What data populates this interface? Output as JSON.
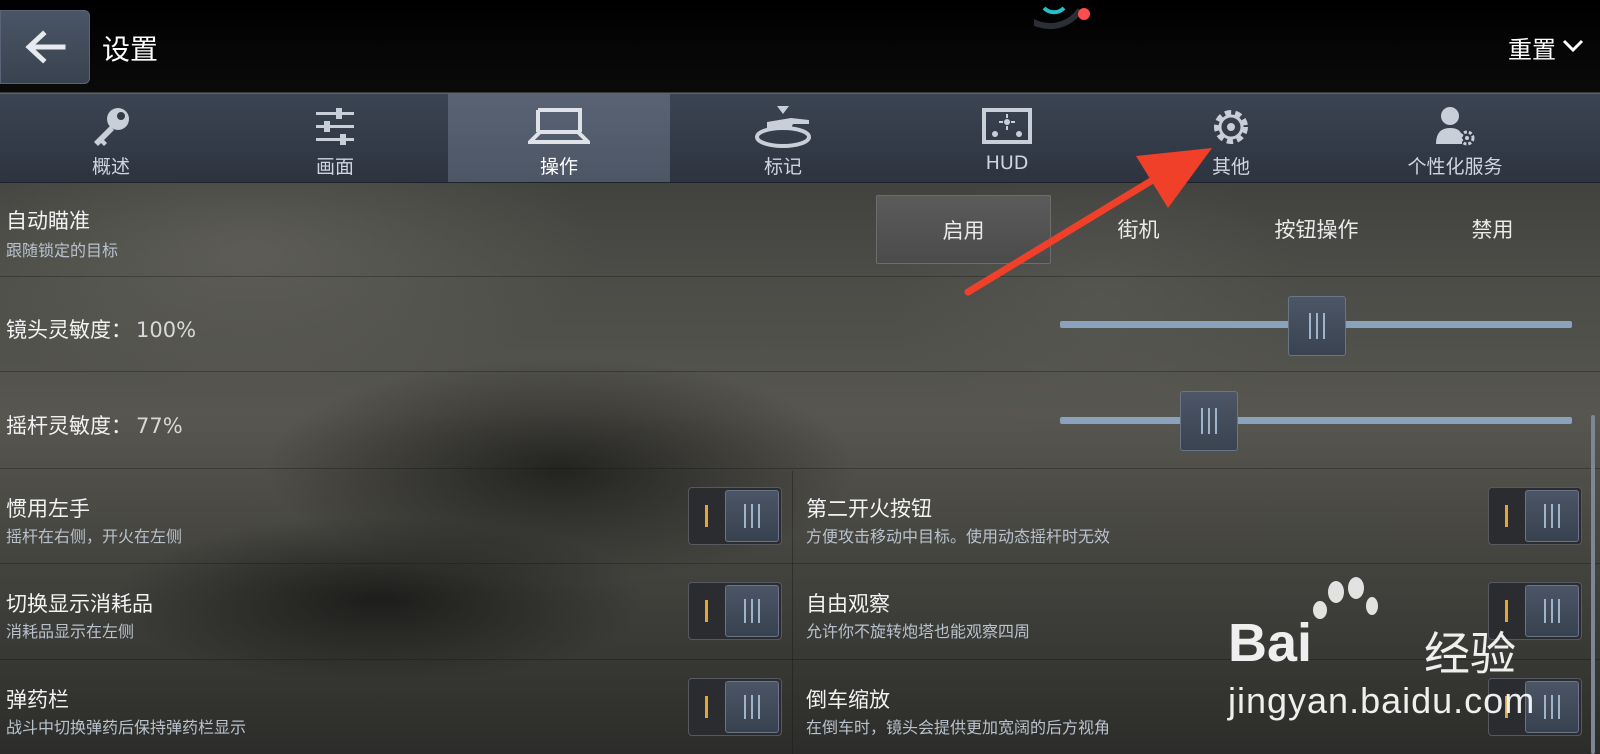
{
  "header": {
    "title": "设置",
    "reset_label": "重置"
  },
  "tabs": [
    {
      "label": "概述",
      "icon": "key-icon"
    },
    {
      "label": "画面",
      "icon": "sliders-icon"
    },
    {
      "label": "操作",
      "icon": "controls-icon",
      "active": true
    },
    {
      "label": "标记",
      "icon": "tank-icon"
    },
    {
      "label": "HUD",
      "icon": "hud-icon"
    },
    {
      "label": "其他",
      "icon": "gear-icon"
    },
    {
      "label": "个性化服务",
      "icon": "user-gear-icon"
    }
  ],
  "auto_aim": {
    "title": "自动瞄准",
    "desc": "跟随锁定的目标",
    "options": [
      "启用",
      "街机",
      "按钮操作",
      "禁用"
    ],
    "selected": "启用"
  },
  "camera_sensitivity": {
    "label": "镜头灵敏度：",
    "value_text": "100%",
    "level": 0.5
  },
  "joystick_sensitivity": {
    "label": "摇杆灵敏度：",
    "value_text": "77%",
    "level": 0.29
  },
  "toggles": [
    {
      "title": "惯用左手",
      "desc": "摇杆在右侧，开火在左侧"
    },
    {
      "title": "第二开火按钮",
      "desc": "方便攻击移动中目标。使用动态摇杆时无效"
    },
    {
      "title": "切换显示消耗品",
      "desc": "消耗品显示在左侧"
    },
    {
      "title": "自由观察",
      "desc": "允许你不旋转炮塔也能观察四周"
    },
    {
      "title": "弹药栏",
      "desc": "战斗中切换弹药后保持弹药栏显示"
    },
    {
      "title": "倒车缩放",
      "desc": "在倒车时，镜头会提供更加宽阔的后方视角"
    }
  ],
  "watermark": {
    "brand": "Bai",
    "brand_tail": "经验",
    "url": "jingyan.baidu.com"
  },
  "colors": {
    "accent_arrow": "#f0402a",
    "toggle_mark": "#e7a432",
    "slider_track": "#8aa2bc"
  }
}
